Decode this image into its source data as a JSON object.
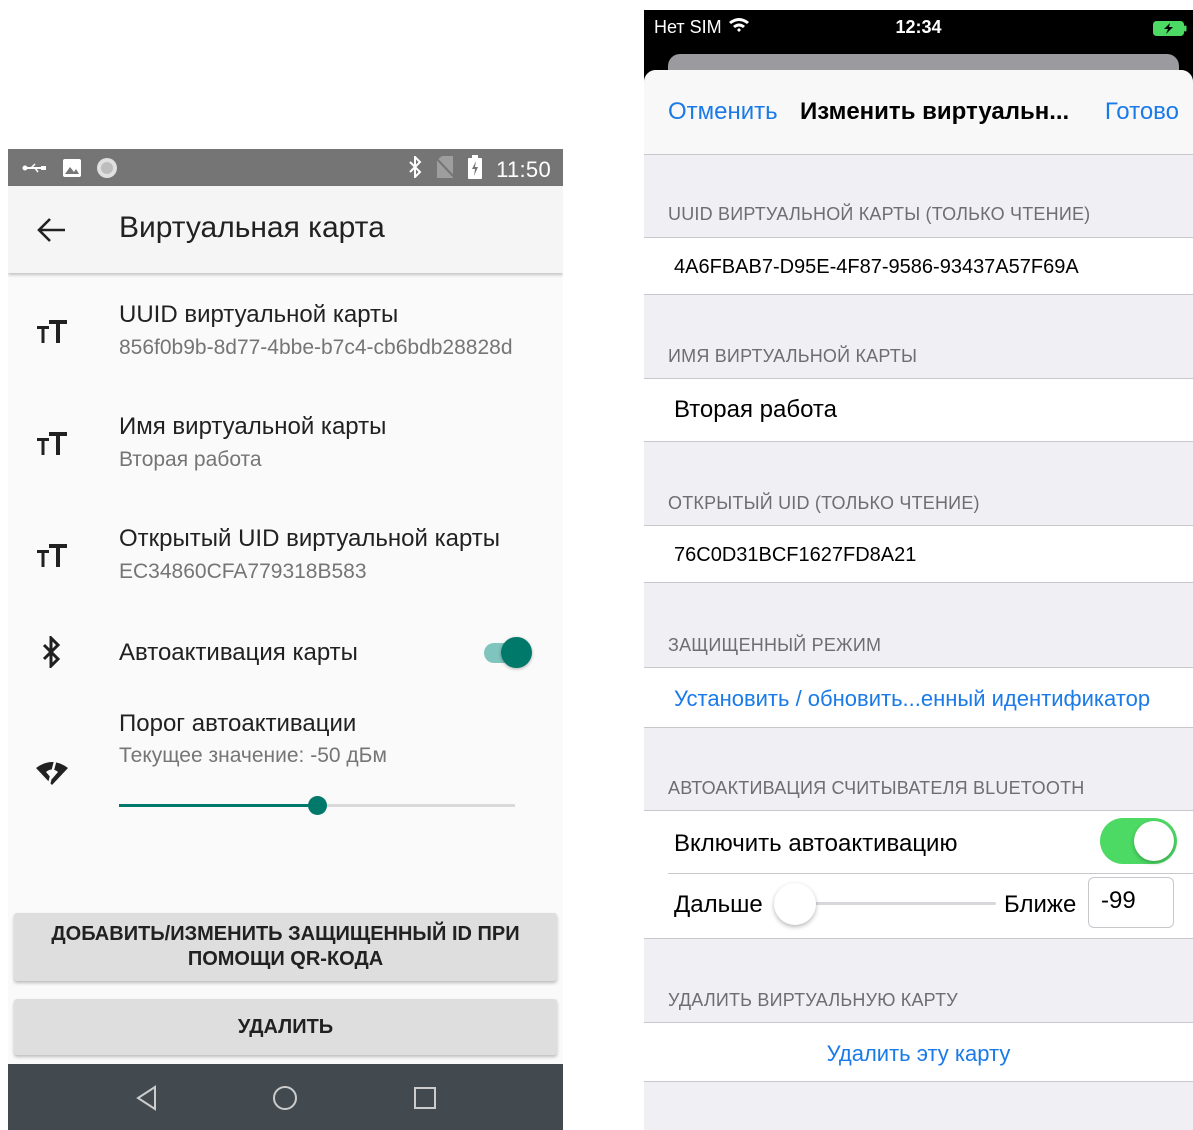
{
  "android": {
    "status_bar": {
      "time": "11:50"
    },
    "app_bar": {
      "title": "Виртуальная карта"
    },
    "settings": [
      {
        "title": "UUID виртуальной карты",
        "subtitle": "856f0b9b-8d77-4bbe-b7c4-cb6bdb28828d",
        "icon": "text-size-icon"
      },
      {
        "title": "Имя виртуальной карты",
        "subtitle": "Вторая работа",
        "icon": "text-size-icon"
      },
      {
        "title": "Открытый UID виртуальной карты",
        "subtitle": "EC34860CFA779318B583",
        "icon": "text-size-icon"
      },
      {
        "title": "Автоактивация карты",
        "icon": "bluetooth-icon",
        "enabled": true
      },
      {
        "title": "Порог автоактивации",
        "subtitle": "Текущее значение: -50 дБм",
        "icon": "wifi-signal-icon",
        "slider_fraction": 0.5
      }
    ],
    "buttons": {
      "qr": "ДОБАВИТЬ/ИЗМЕНИТЬ ЗАЩИЩЕННЫЙ ID ПРИ ПОМОЩИ QR-КОДА",
      "delete": "УДАЛИТЬ"
    },
    "accent_color": "#00796b"
  },
  "ios": {
    "status_bar": {
      "carrier": "Нет SIM",
      "time": "12:34"
    },
    "nav": {
      "cancel": "Отменить",
      "title": "Изменить виртуальн...",
      "done": "Готово"
    },
    "sections": {
      "uuid": {
        "header": "UUID ВИРТУАЛЬНОЙ КАРТЫ (ТОЛЬКО ЧТЕНИЕ)",
        "value": "4A6FBAB7-D95E-4F87-9586-93437A57F69A"
      },
      "name": {
        "header": "ИМЯ ВИРТУАЛЬНОЙ КАРТЫ",
        "value": "Вторая работа"
      },
      "open_uid": {
        "header": "ОТКРЫТЫЙ UID (ТОЛЬКО ЧТЕНИЕ)",
        "value": "76C0D31BCF1627FD8A21"
      },
      "secure": {
        "header": "ЗАЩИЩЕННЫЙ РЕЖИМ",
        "link": "Установить / обновить...енный идентификатор"
      },
      "auto": {
        "header": "АВТОАКТИВАЦИЯ СЧИТЫВАТЕЛЯ BLUETOOTH",
        "toggle_label": "Включить автоактивацию",
        "enabled": true,
        "far_label": "Дальше",
        "near_label": "Ближе",
        "value": "-99",
        "slider_fraction": 0.0
      },
      "delete": {
        "header": "УДАЛИТЬ ВИРТУАЛЬНУЮ КАРТУ",
        "link": "Удалить эту карту"
      }
    },
    "accent_color": "#1a7ae8",
    "switch_color": "#4cd964"
  }
}
